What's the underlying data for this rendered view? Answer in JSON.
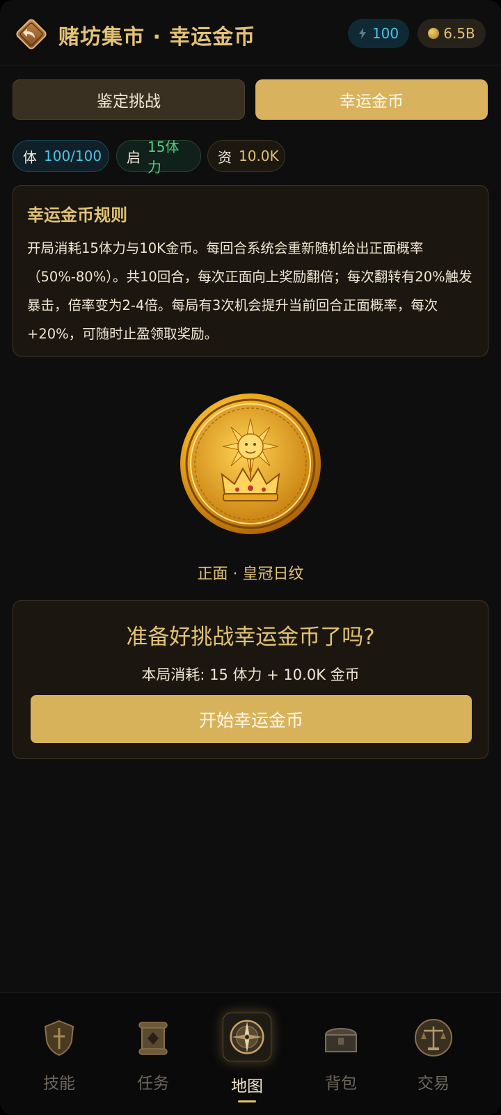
{
  "header": {
    "title": "赌坊集市 · 幸运金币",
    "energy": "100",
    "gold": "6.5B"
  },
  "tabs": [
    {
      "label": "鉴定挑战",
      "active": false
    },
    {
      "label": "幸运金币",
      "active": true
    }
  ],
  "status": {
    "stamina_label": "体",
    "stamina_value": "100/100",
    "start_label": "启",
    "start_value": "15体力",
    "fund_label": "资",
    "fund_value": "10.0K"
  },
  "rules": {
    "title": "幸运金币规则",
    "text": "开局消耗15体力与10K金币。每回合系统会重新随机给出正面概率（50%-80%）。共10回合，每次正面向上奖励翻倍；每次翻转有20%触发暴击，倍率变为2-4倍。每局有3次机会提升当前回合正面概率，每次+20%，可随时止盈领取奖励。"
  },
  "coin": {
    "face_label": "正面 · 皇冠日纹"
  },
  "challenge": {
    "title": "准备好挑战幸运金币了吗?",
    "cost": "本局消耗: 15 体力 + 10.0K 金币",
    "start_label": "开始幸运金币"
  },
  "nav": [
    {
      "label": "技能",
      "icon": "shield-icon",
      "active": false
    },
    {
      "label": "任务",
      "icon": "scroll-icon",
      "active": false
    },
    {
      "label": "地图",
      "icon": "compass-icon",
      "active": true
    },
    {
      "label": "背包",
      "icon": "chest-icon",
      "active": false
    },
    {
      "label": "交易",
      "icon": "scale-icon",
      "active": false
    }
  ],
  "colors": {
    "accent_gold": "#e2c275",
    "button_gold": "#d8b25b",
    "energy_blue": "#4fc4e4",
    "green": "#4fd07d",
    "background": "#0e0e0f"
  }
}
